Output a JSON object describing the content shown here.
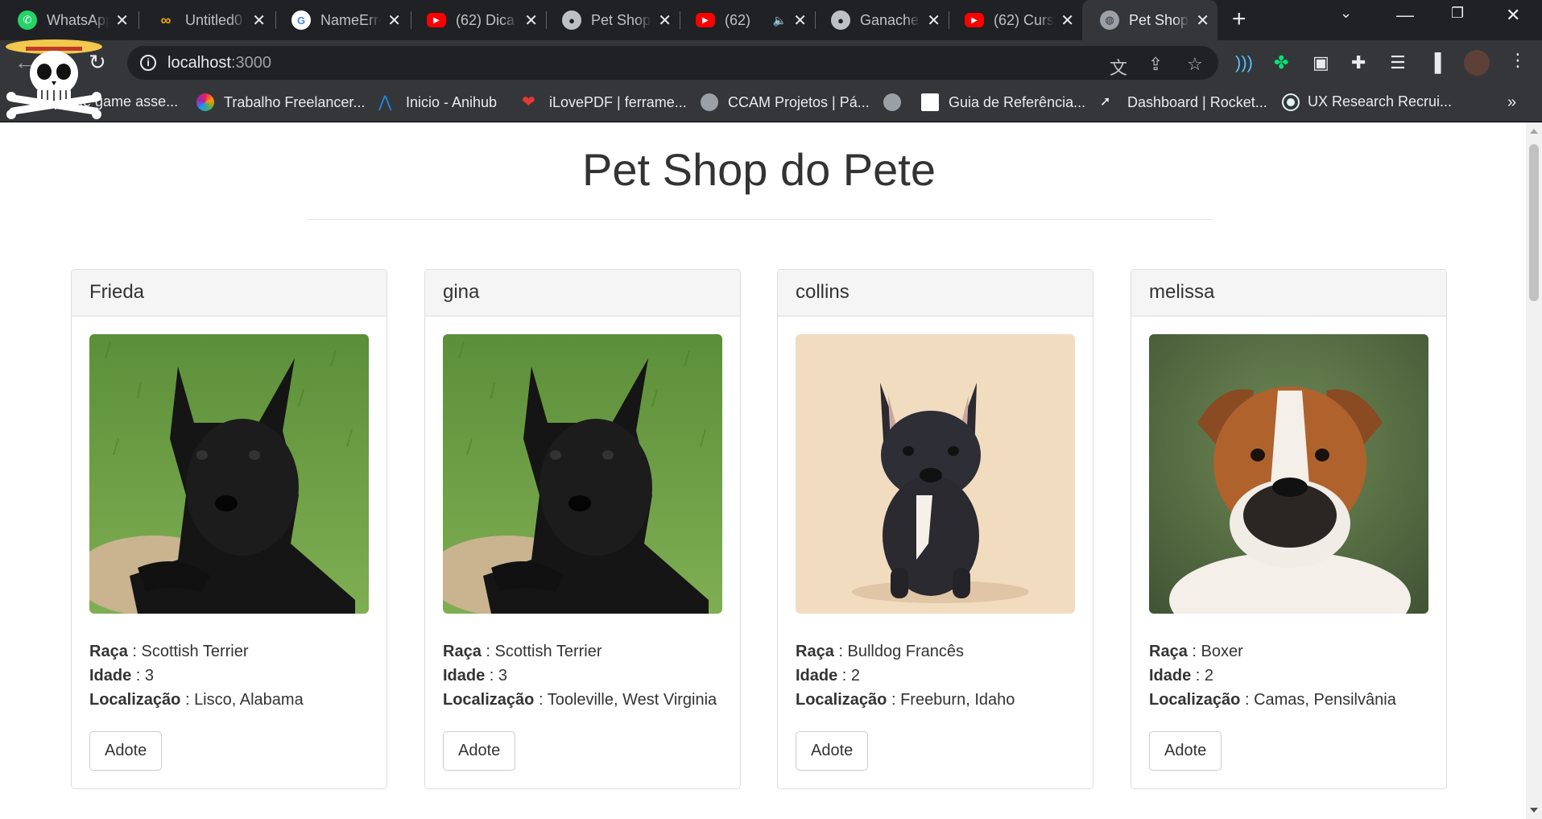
{
  "browser": {
    "tabs": [
      {
        "title": "WhatsApp",
        "icon": "whatsapp-icon",
        "color": "#25d366"
      },
      {
        "title": "Untitled0",
        "icon": "colab-icon",
        "color": "#f9ab00"
      },
      {
        "title": "NameError",
        "icon": "google-icon",
        "color": "#4285f4"
      },
      {
        "title": "(62) Dica",
        "icon": "youtube-icon",
        "color": "#ff0000"
      },
      {
        "title": "Pet Shop",
        "icon": "github-icon",
        "color": "#bdc1c6"
      },
      {
        "title": "(62)",
        "icon": "youtube-icon",
        "color": "#ff0000"
      },
      {
        "title": "Ganache",
        "icon": "github-icon",
        "color": "#bdc1c6"
      },
      {
        "title": "(62) Curs",
        "icon": "youtube-icon",
        "color": "#ff0000"
      },
      {
        "title": "Pet Shop",
        "icon": "globe-icon",
        "color": "#9aa0a6"
      }
    ],
    "url_host": "localhost",
    "url_port": ":3000",
    "bookmarks": [
      {
        "label": "Top free game asse...",
        "color": "#e91e63"
      },
      {
        "label": "Trabalho Freelancer...",
        "color": "#7b1fa2"
      },
      {
        "label": "Inicio - Anihub",
        "color": "#1e88e5"
      },
      {
        "label": "iLovePDF | ferrame...",
        "color": "#e53935"
      },
      {
        "label": "CCAM Projetos | Pá...",
        "color": "#9aa0a6"
      },
      {
        "label": "",
        "color": "#9aa0a6"
      },
      {
        "label": "Guia de Referência...",
        "color": "#ffffff"
      },
      {
        "label": "Dashboard | Rocket...",
        "color": "#000000"
      },
      {
        "label": "UX Research Recrui...",
        "color": "#e0f2f1"
      }
    ]
  },
  "page": {
    "title": "Pet Shop do Pete",
    "labels": {
      "breed": "Raça",
      "age": "Idade",
      "location": "Localização",
      "adopt": "Adote"
    },
    "pets": [
      {
        "name": "Frieda",
        "breed": "Scottish Terrier",
        "age": "3",
        "location": "Lisco, Alabama",
        "photo": "scottish-terrier"
      },
      {
        "name": "gina",
        "breed": "Scottish Terrier",
        "age": "3",
        "location": "Tooleville, West Virginia",
        "photo": "scottish-terrier"
      },
      {
        "name": "collins",
        "breed": "Bulldog Francês",
        "age": "2",
        "location": "Freeburn, Idaho",
        "photo": "french-bulldog"
      },
      {
        "name": "melissa",
        "breed": "Boxer",
        "age": "2",
        "location": "Camas, Pensilvânia",
        "photo": "boxer"
      }
    ]
  },
  "colors": {
    "chrome_dark": "#202124",
    "chrome_toolbar": "#35363a",
    "card_header": "#f5f5f5",
    "text": "#333333"
  }
}
